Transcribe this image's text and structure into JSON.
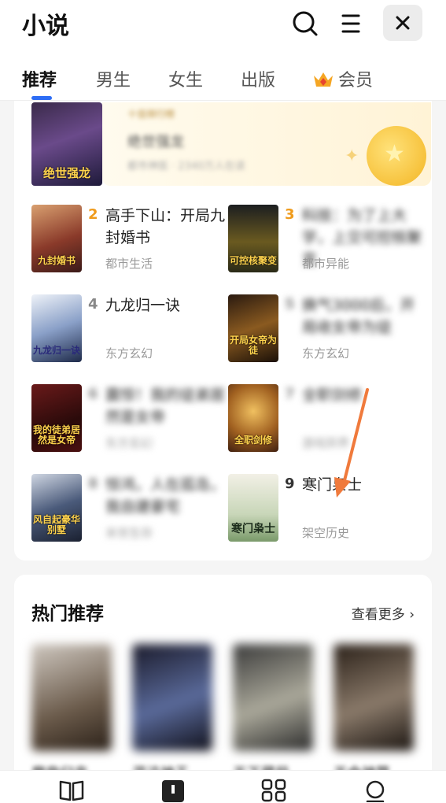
{
  "header": {
    "title": "小说",
    "icons": [
      "search-icon",
      "menu-icon",
      "close-icon"
    ],
    "close_symbol": "✕"
  },
  "tabs": [
    {
      "label": "推荐",
      "active": true
    },
    {
      "label": "男生",
      "active": false
    },
    {
      "label": "女生",
      "active": false
    },
    {
      "label": "出版",
      "active": false
    },
    {
      "label": "会员",
      "active": false,
      "icon": "crown-icon"
    }
  ],
  "ranking": {
    "banner": {
      "top": "十佳排行榜",
      "title": "绝世强龙",
      "sub": "都市神医 · 2340万人在读"
    },
    "cover_texts": {
      "b1": "绝世强龙",
      "b2": "九封婚书",
      "b3": "可控核聚变",
      "b4": "九龙归一诀",
      "b5": "开局女帝为徒",
      "b6": "我的徒弟居然是女帝",
      "b7": "全职剑修",
      "b8": "风自起豪华别墅",
      "b9": "寒门枭士"
    },
    "items": [
      {
        "rank": "2",
        "title": "高手下山：开局九封婚书",
        "category": "都市生活"
      },
      {
        "rank": "3",
        "title": "科技：为了上大学，上交可控核聚变",
        "category": "都市异能"
      },
      {
        "rank": "4",
        "title": "九龙归一诀",
        "category": "东方玄幻"
      },
      {
        "rank": "5",
        "title": "换气3000后，开局收女帝为徒",
        "category": "东方玄幻"
      },
      {
        "rank": "6",
        "title": "震惊！我的徒弟居然是女帝",
        "category": "东方玄幻"
      },
      {
        "rank": "7",
        "title": "全职剑修",
        "category": "游戏异界"
      },
      {
        "rank": "8",
        "title": "惊鸿，人在孤岛，我自建豪宅",
        "category": "末世生存"
      },
      {
        "rank": "9",
        "title": "寒门枭士",
        "category": "架空历史"
      }
    ]
  },
  "hot": {
    "title": "热门推荐",
    "see_more": "查看更多",
    "see_more_icon": "chevron-right-icon",
    "books": [
      "魔帝归来",
      "混沌神王",
      "天下藏局",
      "天命神算"
    ]
  },
  "bottom_nav": {
    "items": [
      "bookshelf-icon",
      "store-icon",
      "category-icon",
      "profile-icon"
    ]
  },
  "colors": {
    "accent": "#2d6df5",
    "rank_gold": "#ef9b1c",
    "annotation_arrow": "#f07a3c"
  }
}
